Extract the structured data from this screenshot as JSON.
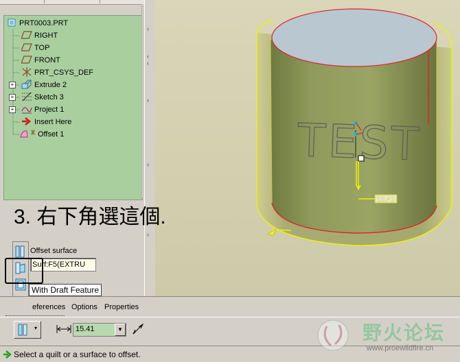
{
  "model_tree": {
    "items": [
      {
        "label": "PRT0003.PRT",
        "icon": "part-icon",
        "expander": ""
      },
      {
        "label": "RIGHT",
        "icon": "datum-plane-icon",
        "expander": ""
      },
      {
        "label": "TOP",
        "icon": "datum-plane-icon",
        "expander": ""
      },
      {
        "label": "FRONT",
        "icon": "datum-plane-icon",
        "expander": ""
      },
      {
        "label": "PRT_CSYS_DEF",
        "icon": "csys-icon",
        "expander": ""
      },
      {
        "label": "Extrude 2",
        "icon": "extrude-icon",
        "expander": "+"
      },
      {
        "label": "Sketch 3",
        "icon": "sketch-icon",
        "expander": "+"
      },
      {
        "label": "Project 1",
        "icon": "project-curve-icon",
        "expander": "+"
      },
      {
        "label": "Insert Here",
        "icon": "insert-arrow-icon",
        "expander": ""
      },
      {
        "label": "Offset 1",
        "icon": "offset-feature-icon",
        "expander": ""
      }
    ]
  },
  "annotation": {
    "text": "3. 右下角選這個."
  },
  "viewport": {
    "engraved_text": "TEST",
    "dimension_value": "15.41",
    "colors": {
      "cylinder": "#8f9a5c",
      "top_face": "#b8c7d0",
      "quilt_edge": "#f2f200",
      "red_edge": "#e0202a"
    }
  },
  "offset_panel": {
    "header": "Offset surface",
    "surface_ref": "Surf:F5(EXTRU",
    "flyout_option": "With Draft Feature"
  },
  "dashboard": {
    "tabs": [
      "eferences",
      "Options",
      "Properties"
    ],
    "offset_value": "15.41"
  },
  "status": {
    "message": "Select a quilt or a surface to offset."
  },
  "watermark": {
    "title": "野火论坛",
    "url": "www.proewildfire.cn"
  }
}
